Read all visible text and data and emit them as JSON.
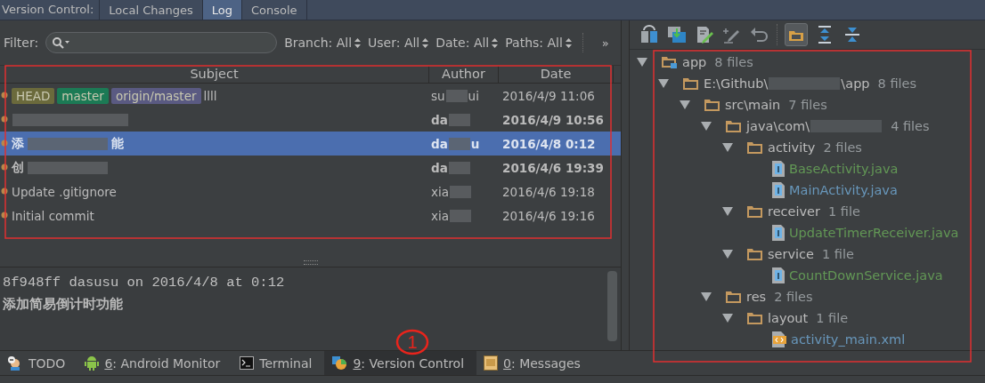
{
  "top_bar": {
    "title": "Version Control:",
    "tabs": [
      {
        "label": "Local Changes",
        "selected": false
      },
      {
        "label": "Log",
        "selected": true
      },
      {
        "label": "Console",
        "selected": false
      }
    ]
  },
  "filter": {
    "label": "Filter:",
    "selectors": [
      "Branch: All",
      "User: All",
      "Date: All",
      "Paths: All"
    ],
    "more": "»"
  },
  "table": {
    "columns": [
      "Subject",
      "Author",
      "Date"
    ],
    "rows": [
      {
        "refs": [
          {
            "name": "HEAD",
            "color": "#6b6a3c"
          },
          {
            "name": "master",
            "color": "#1c7a55"
          },
          {
            "name": "origin/master",
            "color": "#5a5a82"
          }
        ],
        "subject": [
          {
            "kind": "text",
            "text": "llll"
          }
        ],
        "author": [
          {
            "kind": "text",
            "text": "su"
          },
          {
            "kind": "blurred"
          },
          {
            "kind": "text",
            "text": "ui"
          }
        ],
        "date": "2016/4/9 11:06",
        "bold": false,
        "selected": false
      },
      {
        "refs": [],
        "subject": [
          {
            "kind": "blurred"
          }
        ],
        "author": [
          {
            "kind": "text",
            "text": "da"
          },
          {
            "kind": "blurred"
          }
        ],
        "date": "2016/4/9 10:56",
        "bold": true,
        "selected": false
      },
      {
        "refs": [],
        "subject": [
          {
            "kind": "text",
            "text": "添"
          },
          {
            "kind": "blurred"
          },
          {
            "kind": "text",
            "text": "能"
          }
        ],
        "author": [
          {
            "kind": "text",
            "text": "da"
          },
          {
            "kind": "blurred"
          },
          {
            "kind": "text",
            "text": "u"
          }
        ],
        "date": "2016/4/8 0:12",
        "bold": true,
        "selected": true
      },
      {
        "refs": [],
        "subject": [
          {
            "kind": "text",
            "text": "创"
          },
          {
            "kind": "blurred"
          }
        ],
        "author": [
          {
            "kind": "text",
            "text": "da"
          },
          {
            "kind": "blurred"
          }
        ],
        "date": "2016/4/6 19:39",
        "bold": true,
        "selected": false
      },
      {
        "refs": [],
        "subject": [
          {
            "kind": "text",
            "text": "Update .gitignore"
          }
        ],
        "author": [
          {
            "kind": "text",
            "text": "xia"
          },
          {
            "kind": "blurred"
          }
        ],
        "date": "2016/4/6 19:18",
        "bold": false,
        "selected": false
      },
      {
        "refs": [],
        "subject": [
          {
            "kind": "text",
            "text": "Initial commit"
          }
        ],
        "author": [
          {
            "kind": "text",
            "text": "xia"
          },
          {
            "kind": "blurred"
          }
        ],
        "date": "2016/4/6 19:16",
        "bold": false,
        "selected": false
      }
    ]
  },
  "details": {
    "header": "8f948ff dasusu on 2016/4/8 at 0:12",
    "message": "添加简易倒计时功能"
  },
  "annotation": "1",
  "tree": [
    {
      "kind": "module",
      "name": [
        "app"
      ],
      "count": "8 files",
      "expanded": true,
      "children": [
        {
          "kind": "folder",
          "name": [
            {
              "kind": "text",
              "text": "E:\\Github\\"
            },
            {
              "kind": "blurred"
            },
            {
              "kind": "text",
              "text": "\\app"
            }
          ],
          "count": "8 files",
          "expanded": true,
          "children": [
            {
              "kind": "folder",
              "name": [
                "src\\main"
              ],
              "count": "7 files",
              "expanded": true,
              "children": [
                {
                  "kind": "folder",
                  "name": [
                    {
                      "kind": "text",
                      "text": "java\\com\\"
                    },
                    {
                      "kind": "blurred"
                    }
                  ],
                  "count": "4 files",
                  "expanded": true,
                  "children": [
                    {
                      "kind": "folder",
                      "name": [
                        "activity"
                      ],
                      "count": "2 files",
                      "expanded": true,
                      "children": [
                        {
                          "kind": "java",
                          "name": [
                            "BaseActivity.java"
                          ],
                          "color": "#629755"
                        },
                        {
                          "kind": "java",
                          "name": [
                            "MainActivity.java"
                          ],
                          "color": "#6897bb"
                        }
                      ]
                    },
                    {
                      "kind": "folder",
                      "name": [
                        "receiver"
                      ],
                      "count": "1 file",
                      "expanded": true,
                      "children": [
                        {
                          "kind": "java",
                          "name": [
                            "UpdateTimerReceiver.java"
                          ],
                          "color": "#629755"
                        }
                      ]
                    },
                    {
                      "kind": "folder",
                      "name": [
                        "service"
                      ],
                      "count": "1 file",
                      "expanded": true,
                      "children": [
                        {
                          "kind": "java",
                          "name": [
                            "CountDownService.java"
                          ],
                          "color": "#629755"
                        }
                      ]
                    }
                  ]
                },
                {
                  "kind": "folder",
                  "name": [
                    "res"
                  ],
                  "count": "2 files",
                  "expanded": true,
                  "children": [
                    {
                      "kind": "folder",
                      "name": [
                        "layout"
                      ],
                      "count": "1 file",
                      "expanded": true,
                      "children": [
                        {
                          "kind": "xml",
                          "name": [
                            "activity_main.xml"
                          ],
                          "color": "#6897bb"
                        }
                      ]
                    }
                  ]
                }
              ]
            }
          ]
        }
      ]
    }
  ],
  "tool_windows": [
    {
      "label": "TODO",
      "kind": "todo",
      "selected": false
    },
    {
      "key": "6",
      "label": ": Android Monitor",
      "kind": "android",
      "selected": false
    },
    {
      "label": "Terminal",
      "kind": "terminal",
      "selected": false
    },
    {
      "key": "9",
      "label": ": Version Control",
      "kind": "vcs",
      "selected": true
    },
    {
      "key": "0",
      "label": ": Messages",
      "kind": "messages",
      "selected": false
    }
  ]
}
